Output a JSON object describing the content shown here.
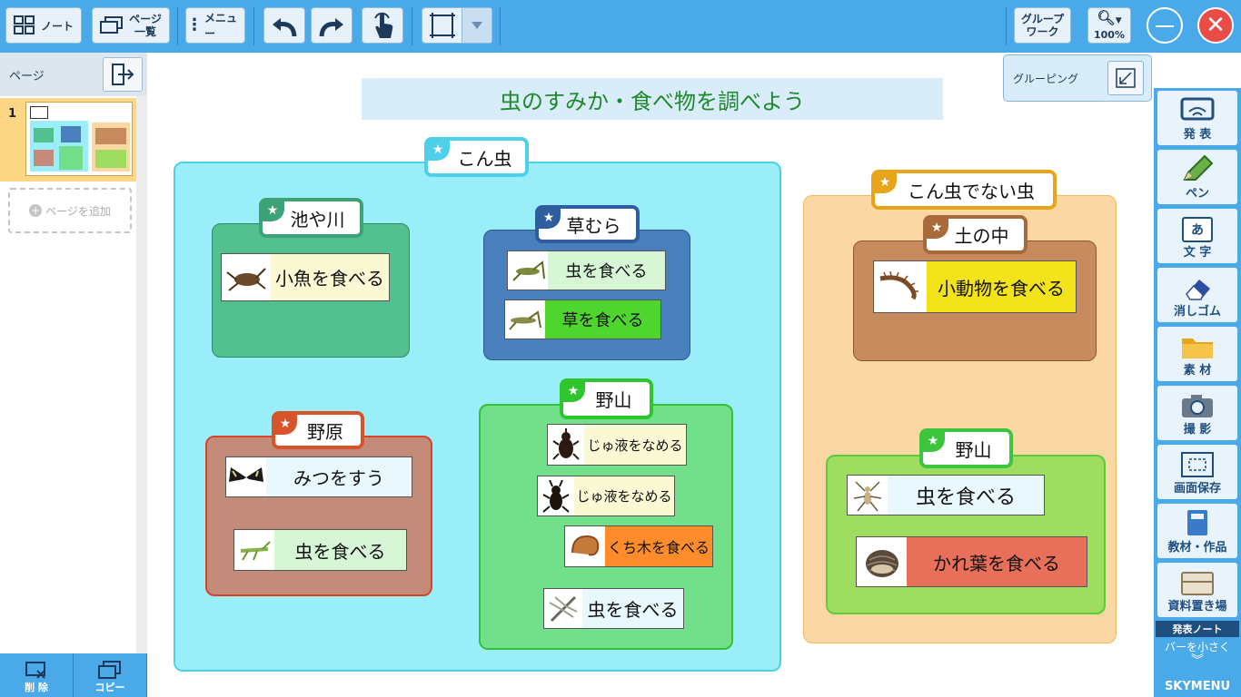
{
  "toolbar": {
    "note_label": "ノート",
    "pagelist_label_1": "ページ",
    "pagelist_label_2": "一覧",
    "menu_label": "メニュー",
    "groupwork_label_1": "グループ",
    "groupwork_label_2": "ワーク",
    "zoom_level": "100%"
  },
  "left_panel": {
    "header": "ページ",
    "page_number": "1",
    "add_page": "ページを追加",
    "delete_label": "削 除",
    "copy_label": "コピー"
  },
  "canvas": {
    "title": "虫のすみか・食べ物を調べよう",
    "grouping_label": "グルーピング",
    "insects": {
      "label": "こん虫",
      "groups": [
        {
          "label": "池や川",
          "cards": [
            "小魚を食べる"
          ]
        },
        {
          "label": "草むら",
          "cards": [
            "虫を食べる",
            "草を食べる"
          ]
        },
        {
          "label": "野原",
          "cards": [
            "みつをすう",
            "虫を食べる"
          ]
        },
        {
          "label": "野山",
          "cards": [
            "じゅ液をなめる",
            "じゅ液をなめる",
            "くち木を食べる",
            "虫を食べる"
          ]
        }
      ]
    },
    "non_insects": {
      "label": "こん虫でない虫",
      "groups": [
        {
          "label": "土の中",
          "cards": [
            "小動物を食べる"
          ]
        },
        {
          "label": "野山",
          "cards": [
            "虫を食べる",
            "かれ葉を食べる"
          ]
        }
      ]
    }
  },
  "tools": {
    "items": [
      "発 表",
      "ペン",
      "文 字",
      "消しゴム",
      "素 材",
      "撮 影",
      "画面保存",
      "教材・作品",
      "資料置き場"
    ],
    "note_label": "発表ノート",
    "shrink_label": "バーを小さく",
    "brand": "SKYMENU"
  },
  "colors": {
    "toolbar": "#4aa9e8",
    "insect_group": "#9aeefa",
    "non_insect_group": "#fad7a3",
    "title_text": "#1f8a2a"
  }
}
